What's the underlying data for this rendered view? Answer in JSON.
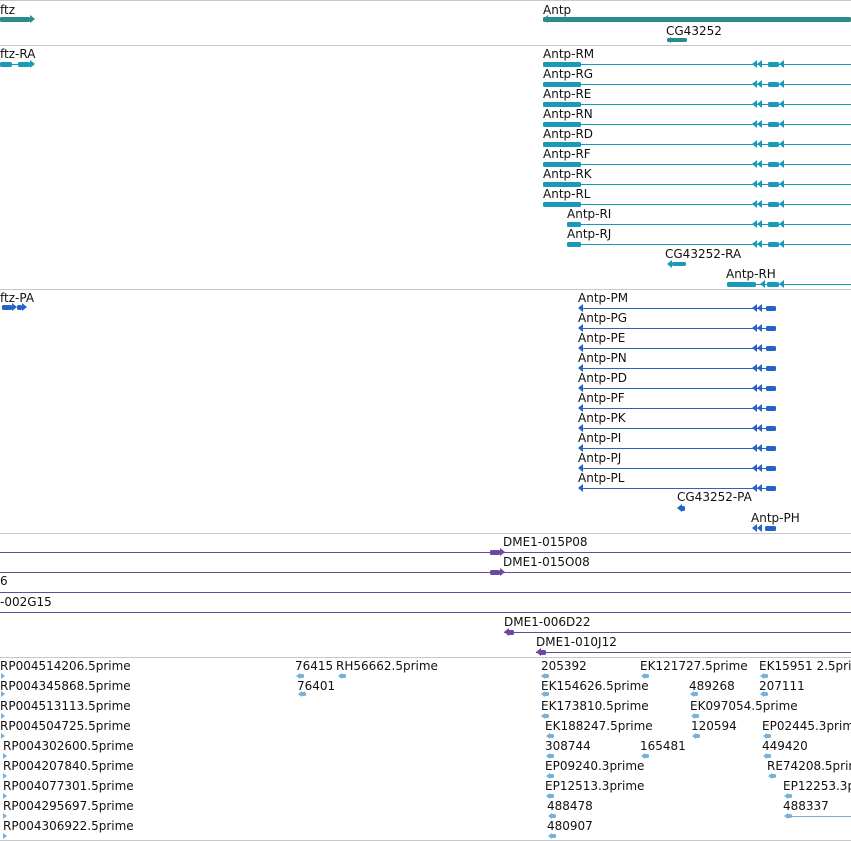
{
  "colors": {
    "gene": "#2b8a8a",
    "rna": "#1a9ab8",
    "protein": "#2563c8",
    "clone": "#6a4a9e",
    "est": "#78b0d8",
    "divider": "#c8c8c8"
  },
  "tracks": {
    "gene": {
      "features": [
        {
          "label": "ftz"
        },
        {
          "label": "Antp"
        },
        {
          "label": "CG43252"
        }
      ]
    },
    "rna": {
      "features": [
        {
          "label": "ftz-RA"
        },
        {
          "label": "Antp-RM"
        },
        {
          "label": "Antp-RG"
        },
        {
          "label": "Antp-RE"
        },
        {
          "label": "Antp-RN"
        },
        {
          "label": "Antp-RD"
        },
        {
          "label": "Antp-RF"
        },
        {
          "label": "Antp-RK"
        },
        {
          "label": "Antp-RL"
        },
        {
          "label": "Antp-RI"
        },
        {
          "label": "Antp-RJ"
        },
        {
          "label": "CG43252-RA"
        },
        {
          "label": "Antp-RH"
        }
      ]
    },
    "protein": {
      "features": [
        {
          "label": "ftz-PA"
        },
        {
          "label": "Antp-PM"
        },
        {
          "label": "Antp-PG"
        },
        {
          "label": "Antp-PE"
        },
        {
          "label": "Antp-PN"
        },
        {
          "label": "Antp-PD"
        },
        {
          "label": "Antp-PF"
        },
        {
          "label": "Antp-PK"
        },
        {
          "label": "Antp-PI"
        },
        {
          "label": "Antp-PJ"
        },
        {
          "label": "Antp-PL"
        },
        {
          "label": "CG43252-PA"
        },
        {
          "label": "Antp-PH"
        }
      ]
    },
    "clone": {
      "features": [
        {
          "label": "DME1-015P08"
        },
        {
          "label": "DME1-015O08"
        },
        {
          "label": "6"
        },
        {
          "label": "-002G15"
        },
        {
          "label": "DME1-006D22"
        },
        {
          "label": "DME1-010J12"
        }
      ]
    },
    "est": {
      "features": [
        {
          "label": "RP004514206.5prime"
        },
        {
          "label": "RP004345868.5prime"
        },
        {
          "label": "RP004513113.5prime"
        },
        {
          "label": "RP004504725.5prime"
        },
        {
          "label": "RP004302600.5prime"
        },
        {
          "label": "RP004207840.5prime"
        },
        {
          "label": "RP004077301.5prime"
        },
        {
          "label": "RP004295697.5prime"
        },
        {
          "label": "RP004306922.5prime"
        },
        {
          "label": "76415"
        },
        {
          "label": "RH56662.5prime"
        },
        {
          "label": "76401"
        },
        {
          "label": "205392"
        },
        {
          "label": "EK154626.5prime"
        },
        {
          "label": "EK173810.5prime"
        },
        {
          "label": "EK188247.5prime"
        },
        {
          "label": "308744"
        },
        {
          "label": "EP09240.3prime"
        },
        {
          "label": "EP12513.3prime"
        },
        {
          "label": "488478"
        },
        {
          "label": "480907"
        },
        {
          "label": "165481"
        },
        {
          "label": "EK121727.5prime"
        },
        {
          "label": "489268"
        },
        {
          "label": "EK097054.5prime"
        },
        {
          "label": "120594"
        },
        {
          "label": "EK15951 2.5pri"
        },
        {
          "label": "207111"
        },
        {
          "label": "EP02445.3prime"
        },
        {
          "label": "449420"
        },
        {
          "label": "RE74208.5prime"
        },
        {
          "label": "EP12253.3p"
        },
        {
          "label": "488337"
        }
      ]
    }
  }
}
